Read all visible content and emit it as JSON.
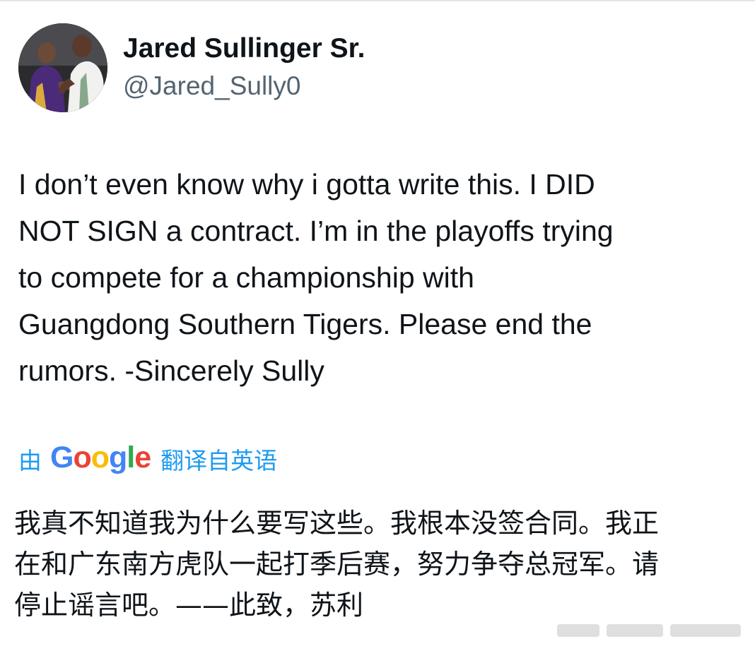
{
  "author": {
    "display_name": "Jared Sullinger Sr.",
    "handle": "@Jared_Sully0",
    "avatar_icon": "profile-photo"
  },
  "tweet": {
    "lines": [
      "I don’t even know why i gotta write this. I DID",
      "NOT SIGN a contract. I’m in the playoffs trying",
      "to compete for a championship with",
      "Guangdong Southern Tigers. Please end the",
      "rumors. -Sincerely Sully"
    ]
  },
  "translation": {
    "prefix": "由",
    "provider": "Google",
    "provider_letters": [
      "G",
      "o",
      "o",
      "g",
      "l",
      "e"
    ],
    "suffix": "翻译自英语",
    "link_color": "#1d9bf0",
    "lines": [
      "我真不知道我为什么要写这些。我根本没签合同。我正",
      "在和广东南方虎队一起打季后赛，努力争夺总冠军。请",
      "停止谣言吧。——此致，苏利"
    ]
  }
}
